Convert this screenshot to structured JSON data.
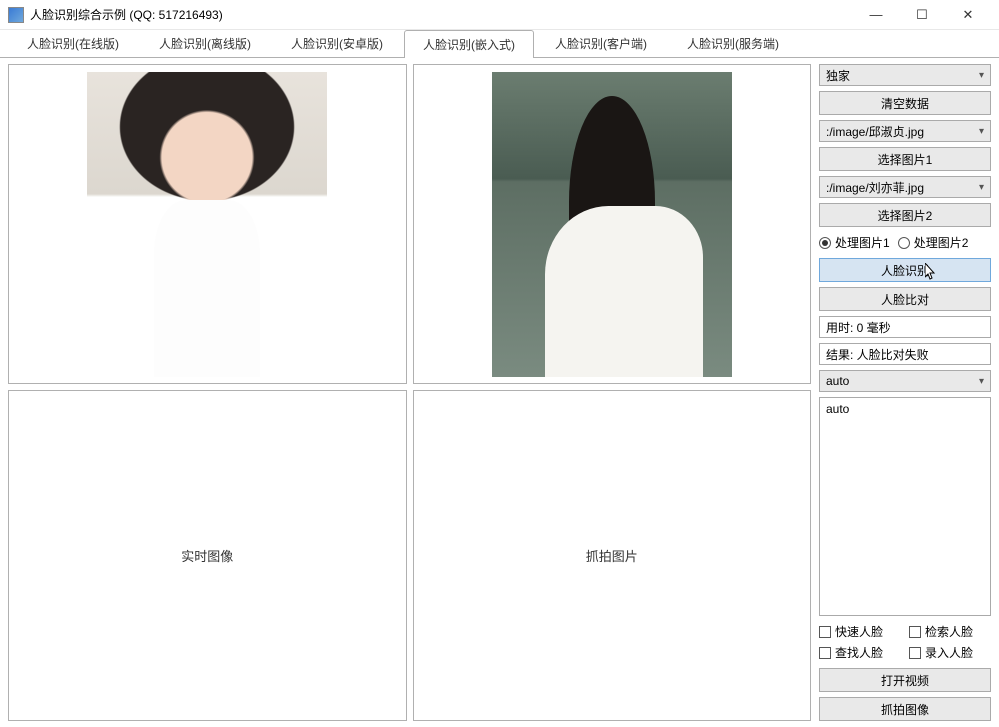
{
  "window": {
    "title": "人脸识别综合示例 (QQ: 517216493)"
  },
  "tabs": [
    {
      "label": "人脸识别(在线版)"
    },
    {
      "label": "人脸识别(离线版)"
    },
    {
      "label": "人脸识别(安卓版)"
    },
    {
      "label": "人脸识别(嵌入式)"
    },
    {
      "label": "人脸识别(客户端)"
    },
    {
      "label": "人脸识别(服务端)"
    }
  ],
  "active_tab": 3,
  "panels": {
    "realtime_label": "实时图像",
    "capture_label": "抓拍图片"
  },
  "sidebar": {
    "source_combo": "独家",
    "clear_btn": "清空数据",
    "image1_combo": ":/image/邱淑贞.jpg",
    "select_img1_btn": "选择图片1",
    "image2_combo": ":/image/刘亦菲.jpg",
    "select_img2_btn": "选择图片2",
    "radio1_label": "处理图片1",
    "radio2_label": "处理图片2",
    "radio_selected": 1,
    "face_recog_btn": "人脸识别",
    "face_compare_btn": "人脸比对",
    "time_text": "用时: 0 毫秒",
    "result_text": "结果: 人脸比对失败",
    "mode_combo": "auto",
    "log_text": "auto",
    "check1": "快速人脸",
    "check2": "检索人脸",
    "check3": "查找人脸",
    "check4": "录入人脸",
    "open_video_btn": "打开视频",
    "capture_btn": "抓拍图像"
  }
}
